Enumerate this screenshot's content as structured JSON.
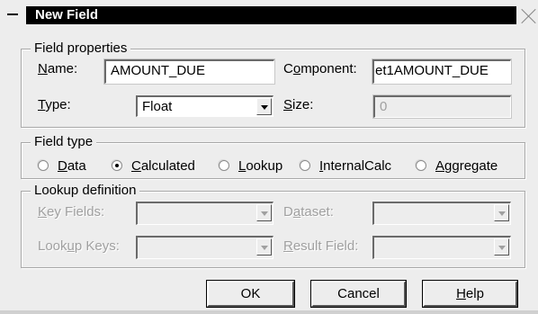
{
  "window": {
    "title": "New Field"
  },
  "field_properties": {
    "legend": "Field properties",
    "name_label_u": "N",
    "name_label_rest": "ame:",
    "name_value": "AMOUNT_DUE",
    "component_label_pre": "C",
    "component_label_u": "o",
    "component_label_rest": "mponent:",
    "component_value": "et1AMOUNT_DUE",
    "type_label_u": "T",
    "type_label_rest": "ype:",
    "type_value": "Float",
    "size_label_u": "S",
    "size_label_rest": "ize:",
    "size_value": "0"
  },
  "field_type": {
    "legend": "Field type",
    "options": [
      {
        "u": "D",
        "rest": "ata",
        "selected": false
      },
      {
        "u": "C",
        "rest": "alculated",
        "selected": true
      },
      {
        "u": "L",
        "rest": "ookup",
        "selected": false
      },
      {
        "u": "I",
        "rest": "nternalCalc",
        "selected": false
      },
      {
        "u": "A",
        "rest": "ggregate",
        "selected": false
      }
    ]
  },
  "lookup_definition": {
    "legend": "Lookup definition",
    "key_fields_u": "K",
    "key_fields_rest": "ey Fields:",
    "dataset_pre": "D",
    "dataset_u": "a",
    "dataset_rest": "taset:",
    "lookup_keys_pre": "Look",
    "lookup_keys_u": "u",
    "lookup_keys_rest": "p Keys:",
    "result_field_u": "R",
    "result_field_rest": "esult Field:"
  },
  "buttons": {
    "ok": "OK",
    "cancel": "Cancel",
    "help_u": "H",
    "help_rest": "elp"
  }
}
